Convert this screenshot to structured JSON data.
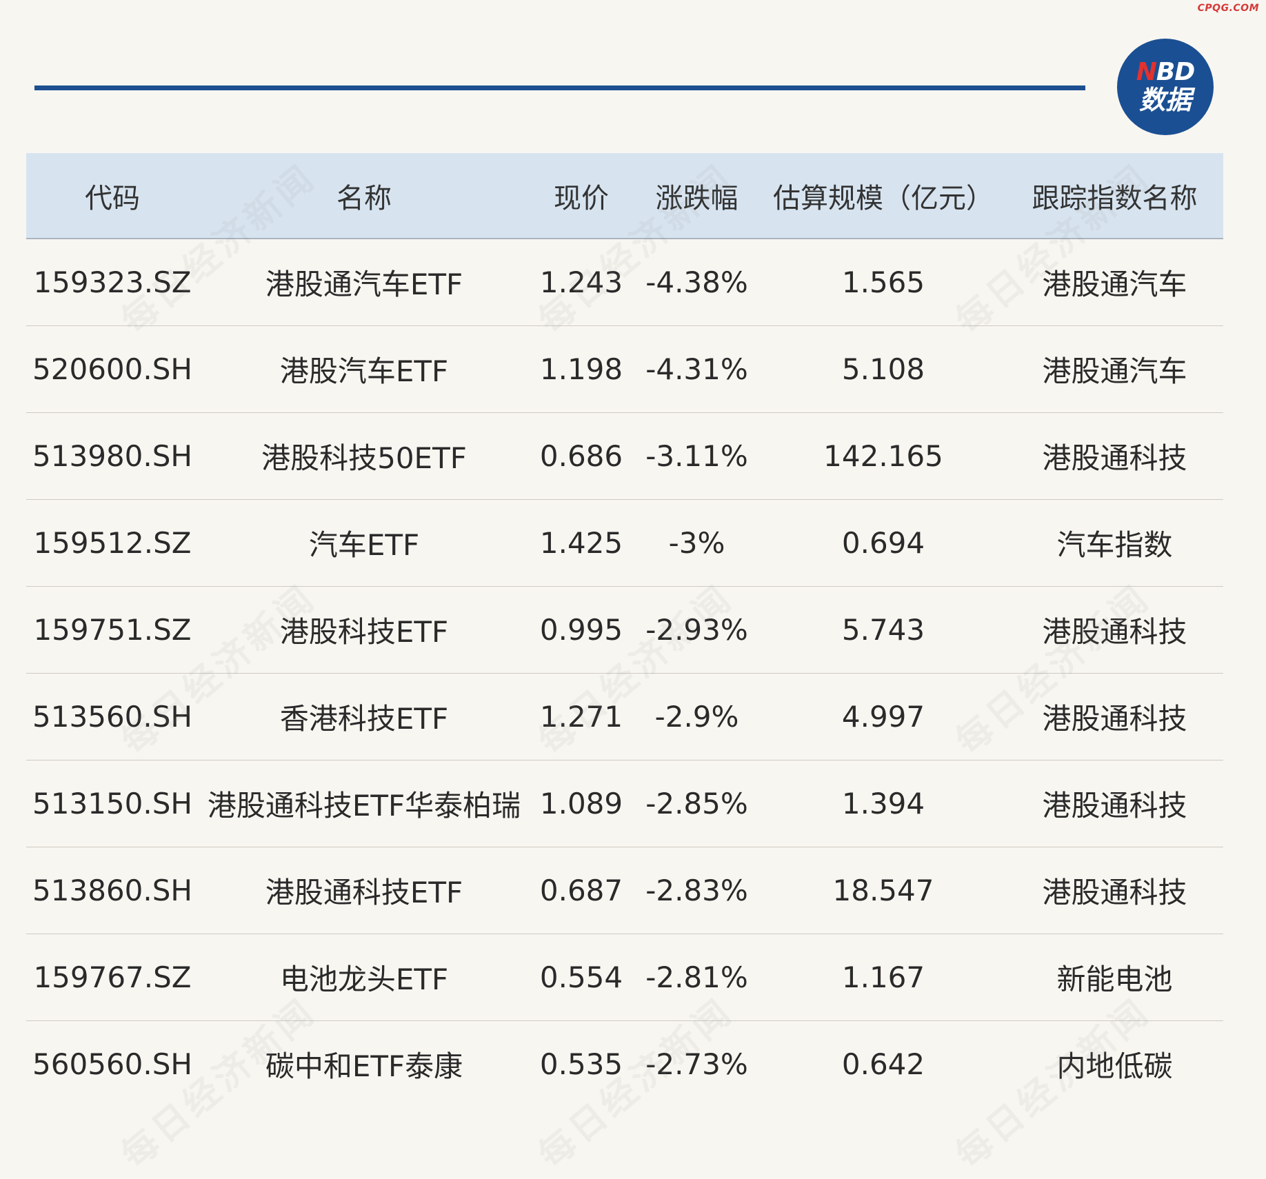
{
  "site_mark": "CPQG.COM",
  "logo": {
    "top_n": "N",
    "top_rest": "BD",
    "bottom": "数据"
  },
  "watermark_text": "每日经济新闻",
  "table": {
    "headers": [
      "代码",
      "名称",
      "现价",
      "涨跌幅",
      "估算规模（亿元）",
      "跟踪指数名称"
    ],
    "rows": [
      [
        "159323.SZ",
        "港股通汽车ETF",
        "1.243",
        "-4.38%",
        "1.565",
        "港股通汽车"
      ],
      [
        "520600.SH",
        "港股汽车ETF",
        "1.198",
        "-4.31%",
        "5.108",
        "港股通汽车"
      ],
      [
        "513980.SH",
        "港股科技50ETF",
        "0.686",
        "-3.11%",
        "142.165",
        "港股通科技"
      ],
      [
        "159512.SZ",
        "汽车ETF",
        "1.425",
        "-3%",
        "0.694",
        "汽车指数"
      ],
      [
        "159751.SZ",
        "港股科技ETF",
        "0.995",
        "-2.93%",
        "5.743",
        "港股通科技"
      ],
      [
        "513560.SH",
        "香港科技ETF",
        "1.271",
        "-2.9%",
        "4.997",
        "港股通科技"
      ],
      [
        "513150.SH",
        "港股通科技ETF华泰柏瑞",
        "1.089",
        "-2.85%",
        "1.394",
        "港股通科技"
      ],
      [
        "513860.SH",
        "港股通科技ETF",
        "0.687",
        "-2.83%",
        "18.547",
        "港股通科技"
      ],
      [
        "159767.SZ",
        "电池龙头ETF",
        "0.554",
        "-2.81%",
        "1.167",
        "新能电池"
      ],
      [
        "560560.SH",
        "碳中和ETF泰康",
        "0.535",
        "-2.73%",
        "0.642",
        "内地低碳"
      ]
    ]
  },
  "colors": {
    "background": "#f8f6f1",
    "accent_blue": "#1d4f91",
    "header_bg": "#d7e4f0",
    "logo_red": "#e2322f"
  }
}
